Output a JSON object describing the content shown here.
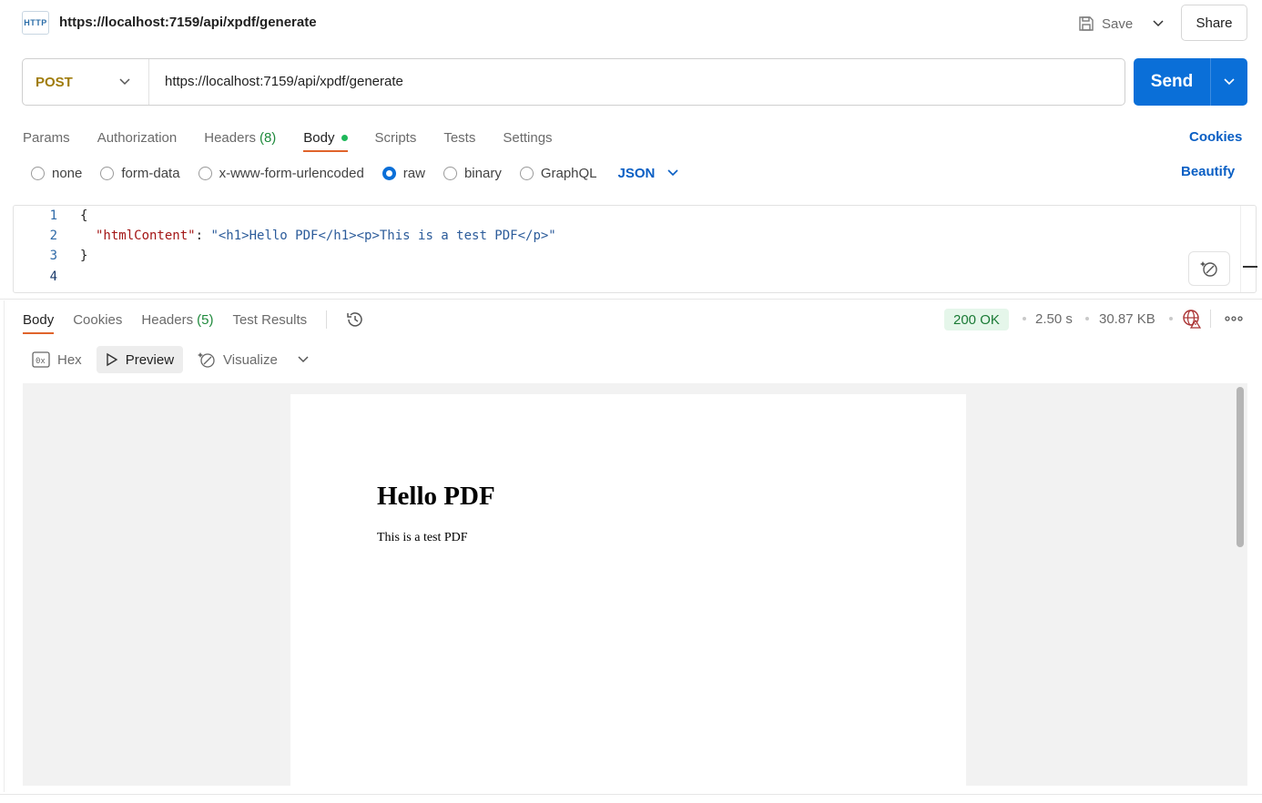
{
  "header": {
    "icon_label": "HTTP",
    "title": "https://localhost:7159/api/xpdf/generate",
    "save_label": "Save",
    "share_label": "Share"
  },
  "request": {
    "method": "POST",
    "url": "https://localhost:7159/api/xpdf/generate",
    "send_label": "Send"
  },
  "request_tabs": {
    "params": "Params",
    "authorization": "Authorization",
    "headers": "Headers",
    "headers_count": "(8)",
    "body": "Body",
    "scripts": "Scripts",
    "tests": "Tests",
    "settings": "Settings",
    "cookies": "Cookies"
  },
  "body_types": {
    "none": "none",
    "form_data": "form-data",
    "urlencoded": "x-www-form-urlencoded",
    "raw": "raw",
    "binary": "binary",
    "graphql": "GraphQL",
    "selected": "raw",
    "format": "JSON",
    "beautify": "Beautify"
  },
  "editor": {
    "line_numbers": [
      "1",
      "2",
      "3",
      "4"
    ],
    "line1": "{",
    "line2_key": "\"htmlContent\"",
    "line2_colon": ": ",
    "line2_value": "\"<h1>Hello PDF</h1><p>This is a test PDF</p>\"",
    "line3": "}"
  },
  "response_tabs": {
    "body": "Body",
    "cookies": "Cookies",
    "headers": "Headers",
    "headers_count": "(5)",
    "test_results": "Test Results"
  },
  "response_meta": {
    "status": "200 OK",
    "time": "2.50 s",
    "size": "30.87 KB"
  },
  "view_modes": {
    "hex": "Hex",
    "preview": "Preview",
    "visualize": "Visualize"
  },
  "preview": {
    "heading": "Hello PDF",
    "paragraph": "This is a test PDF"
  },
  "colors": {
    "accent": "#0a6fd8",
    "method": "#a07c0c",
    "status_ok_bg": "#e5f6ea",
    "status_ok_text": "#1a7a35",
    "active_tab_underline": "#e0642b"
  }
}
